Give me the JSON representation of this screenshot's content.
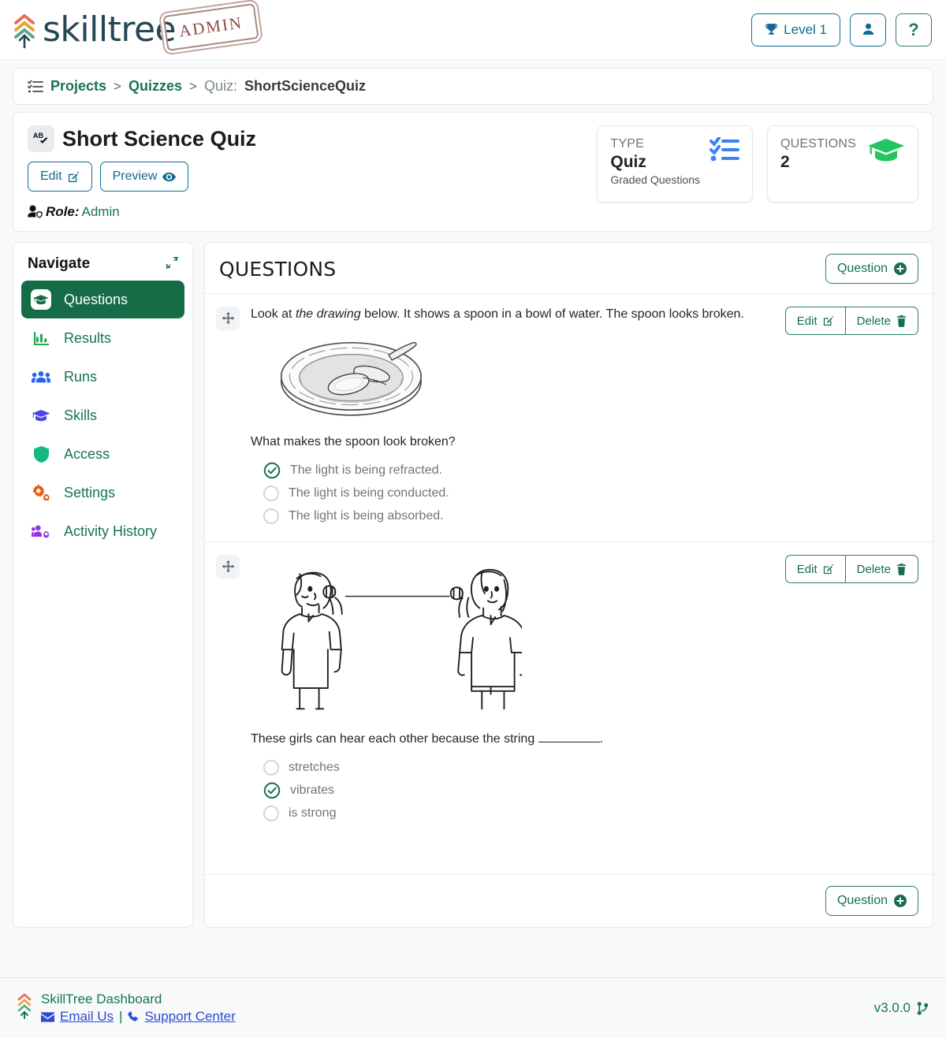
{
  "header": {
    "brand": "skilltree",
    "stamp": "ADMIN",
    "level_button": "Level 1",
    "level_icon": "trophy-icon",
    "user_icon": "user-icon",
    "help_icon": "question-mark-icon"
  },
  "breadcrumb": {
    "list_icon": "list-check-icon",
    "projects": "Projects",
    "quizzes": "Quizzes",
    "separator": ">",
    "current_label": "Quiz:",
    "current_value": "ShortScienceQuiz"
  },
  "page": {
    "icon": "spell-check-icon",
    "title": "Short Science Quiz",
    "edit_button": "Edit",
    "edit_icon": "pencil-square-icon",
    "preview_button": "Preview",
    "preview_icon": "eye-icon",
    "role_icon": "user-shield-icon",
    "role_label": "Role:",
    "role_value": "Admin"
  },
  "stats": [
    {
      "label": "TYPE",
      "value": "Quiz",
      "sub": "Graded Questions",
      "icon": "list-check-blue-icon",
      "color": "#3b82f6"
    },
    {
      "label": "QUESTIONS",
      "value": "2",
      "sub": "",
      "icon": "graduation-cap-icon",
      "color": "#22c55e"
    }
  ],
  "navigate": {
    "title": "Navigate",
    "pin_icon": "compress-arrows-icon",
    "items": [
      {
        "label": "Questions",
        "icon": "graduation-cap-icon",
        "active": true,
        "color": "#ffffff"
      },
      {
        "label": "Results",
        "icon": "chart-bar-icon",
        "active": false,
        "color": "#16a34a"
      },
      {
        "label": "Runs",
        "icon": "users-icon",
        "active": false,
        "color": "#2563eb"
      },
      {
        "label": "Skills",
        "icon": "graduation-cap-icon",
        "active": false,
        "color": "#4f46e5"
      },
      {
        "label": "Access",
        "icon": "shield-icon",
        "active": false,
        "color": "#10b981"
      },
      {
        "label": "Settings",
        "icon": "gears-icon",
        "active": false,
        "color": "#ea580c"
      },
      {
        "label": "Activity History",
        "icon": "users-gear-icon",
        "active": false,
        "color": "#9333ea"
      }
    ]
  },
  "questions_panel": {
    "title": "QUESTIONS",
    "add_question_top": "Question",
    "add_question_bottom": "Question",
    "add_icon": "plus-circle-icon",
    "drag_icon": "arrows-move-icon",
    "edit_label": "Edit",
    "edit_icon": "pencil-square-icon",
    "delete_label": "Delete",
    "delete_icon": "trash-icon"
  },
  "questions": [
    {
      "intro_prefix": "Look at ",
      "intro_italic": "the drawing",
      "intro_suffix": " below. It shows a spoon in a bowl of water. The spoon looks broken.",
      "image": "spoon-in-bowl-of-water-illustration",
      "prompt": "What makes the spoon look broken?",
      "answers": [
        {
          "text": "The light is being refracted.",
          "correct": true
        },
        {
          "text": "The light is being conducted.",
          "correct": false
        },
        {
          "text": "The light is being absorbed.",
          "correct": false
        }
      ]
    },
    {
      "intro_prefix": "",
      "intro_italic": "",
      "intro_suffix": "",
      "image": "two-girls-tin-can-telephone-illustration",
      "prompt_prefix": "These girls can hear each other because the string ",
      "prompt_suffix": ".",
      "answers": [
        {
          "text": "stretches",
          "correct": false
        },
        {
          "text": "vibrates",
          "correct": true
        },
        {
          "text": "is strong",
          "correct": false
        }
      ]
    }
  ],
  "footer": {
    "logo_icon": "skilltree-chevrons-icon",
    "title": "SkillTree Dashboard",
    "email_icon": "envelope-icon",
    "email_link": "Email Us",
    "divider": "|",
    "phone_icon": "phone-icon",
    "support_link": "Support Center",
    "version": "v3.0.0",
    "version_icon": "code-branch-icon"
  }
}
